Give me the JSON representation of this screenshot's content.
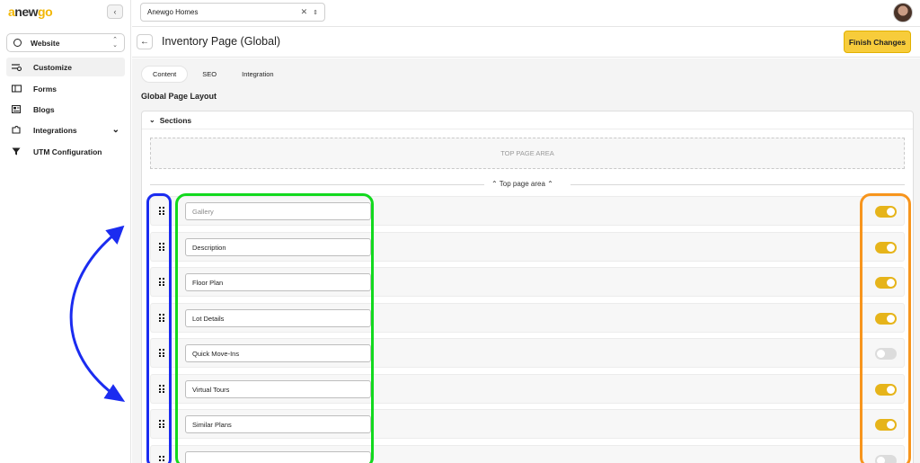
{
  "sidebar": {
    "logo": {
      "pre": "",
      "letters": [
        "a",
        "n",
        "e",
        "w",
        "g",
        "o"
      ]
    },
    "collapse_icon": "chevron-left-icon",
    "site_select": {
      "label": "Website"
    },
    "items": [
      {
        "label": "Customize",
        "icon": "sliders-icon",
        "active": true
      },
      {
        "label": "Forms",
        "icon": "forms-icon"
      },
      {
        "label": "Blogs",
        "icon": "newspaper-icon"
      },
      {
        "label": "Integrations",
        "icon": "puzzle-icon",
        "has_chevron": true
      },
      {
        "label": "UTM Configuration",
        "icon": "funnel-icon"
      }
    ]
  },
  "topbar": {
    "builder_select": "Anewgo Homes"
  },
  "header": {
    "title": "Inventory Page (Global)",
    "finish_label": "Finish Changes"
  },
  "tabs": [
    {
      "label": "Content",
      "active": true
    },
    {
      "label": "SEO"
    },
    {
      "label": "Integration"
    }
  ],
  "layout_title": "Global Page Layout",
  "sections": {
    "title": "Sections",
    "top_area_label": "TOP PAGE AREA",
    "divider_label": "Top page area",
    "rows": [
      {
        "label": "Gallery",
        "enabled": true,
        "placeholder_style": true
      },
      {
        "label": "Description",
        "enabled": true
      },
      {
        "label": "Floor Plan",
        "enabled": true
      },
      {
        "label": "Lot Details",
        "enabled": true
      },
      {
        "label": "Quick Move-Ins",
        "enabled": false
      },
      {
        "label": "Virtual Tours",
        "enabled": true
      },
      {
        "label": "Similar Plans",
        "enabled": true
      }
    ]
  },
  "colors": {
    "accent": "#f7cc3b",
    "toggle_on": "#e6b41a",
    "annotation_blue": "#1b2cf0",
    "annotation_green": "#12d91e",
    "annotation_orange": "#f7951d"
  }
}
